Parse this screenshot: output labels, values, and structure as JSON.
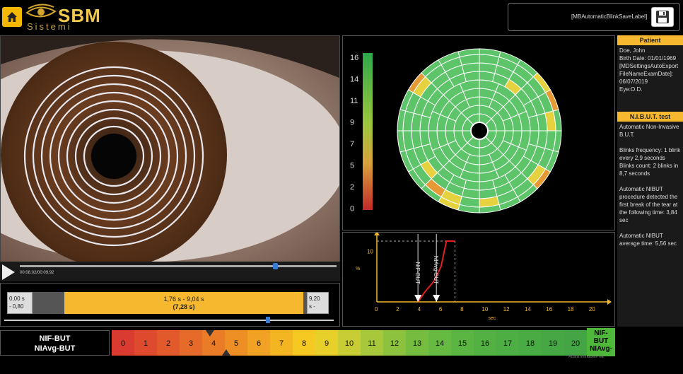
{
  "header": {
    "logo_main": "SBM",
    "logo_sub": "Sistemi",
    "save_label": "[MBAutomaticBlinkSaveLabel]"
  },
  "video": {
    "time": "00:08.02/00:09.92",
    "progress": 0.807
  },
  "range": {
    "left_line1": "0,00 s",
    "left_line2": "- 0,80",
    "center_line1": "1,76 s - 9,04 s",
    "center_line2": "(7,28 s)",
    "right_line1": "9,20",
    "right_line2": "s -",
    "slider_value": 0.81
  },
  "map": {
    "scale_labels": [
      "16",
      "14",
      "11",
      "9",
      "7",
      "5",
      "2",
      "0"
    ],
    "colors": {
      "green": "#5ec46a",
      "yellow": "#e6d23e",
      "orange": "#e59a35",
      "red": "#c0392b"
    }
  },
  "graph": {
    "y_axis_label": "%",
    "y_tick": "10",
    "x_label": "sec",
    "x_ticks": [
      "0",
      "2",
      "4",
      "6",
      "8",
      "10",
      "12",
      "14",
      "16",
      "18",
      "20"
    ],
    "marker1": "NIF-BUT",
    "marker2": "NIAvg-BUT"
  },
  "chart_data": {
    "type": "line",
    "x_label": "sec",
    "y_label": "%",
    "x_range": [
      0,
      21
    ],
    "y_range": [
      0,
      12
    ],
    "series": [
      {
        "x": [
          3.84,
          4.5,
          5.3,
          6.0,
          6.5,
          7.3
        ],
        "y": [
          0,
          2,
          4,
          7,
          12,
          12
        ]
      }
    ],
    "markers": [
      {
        "name": "NIF-BUT",
        "x": 3.84
      },
      {
        "name": "NIAvg-BUT",
        "x": 5.56
      }
    ]
  },
  "patient": {
    "title": "Patient",
    "text": "Doe, John\nBirth Date: 01/01/1969\n[MDSettingsAutoExport\nFileNameExamDate]:\n06/07/2019\nEye:O.D."
  },
  "nibut": {
    "title": "N.I.B.U.T. test",
    "text": "Automatic Non-Invasive\nB.U.T.\n\nBlinks frequency: 1 blink\nevery 2,9 seconds\nBlinks count: 2 blinks in\n8,7 seconds\n\nAutomatic NIBUT\nprocedure detected the\nfirst break of the tear at\nthe following time: 3,84\nsec\n\nAutomatic NIBUT\naverage  time: 5,56 sec"
  },
  "bottom": {
    "line1": "NIF-BUT",
    "line2": "NIAvg-BUT",
    "scale_numbers": [
      "0",
      "1",
      "2",
      "3",
      "4",
      "5",
      "6",
      "7",
      "8",
      "9",
      "10",
      "11",
      "12",
      "13",
      "14",
      "15",
      "16",
      "17",
      "18",
      "19",
      "20"
    ],
    "end_line1": "NIF-",
    "end_line2": "BUT",
    "end_line3": "NIAvg-",
    "watermark": "Attiva Windows Va"
  }
}
